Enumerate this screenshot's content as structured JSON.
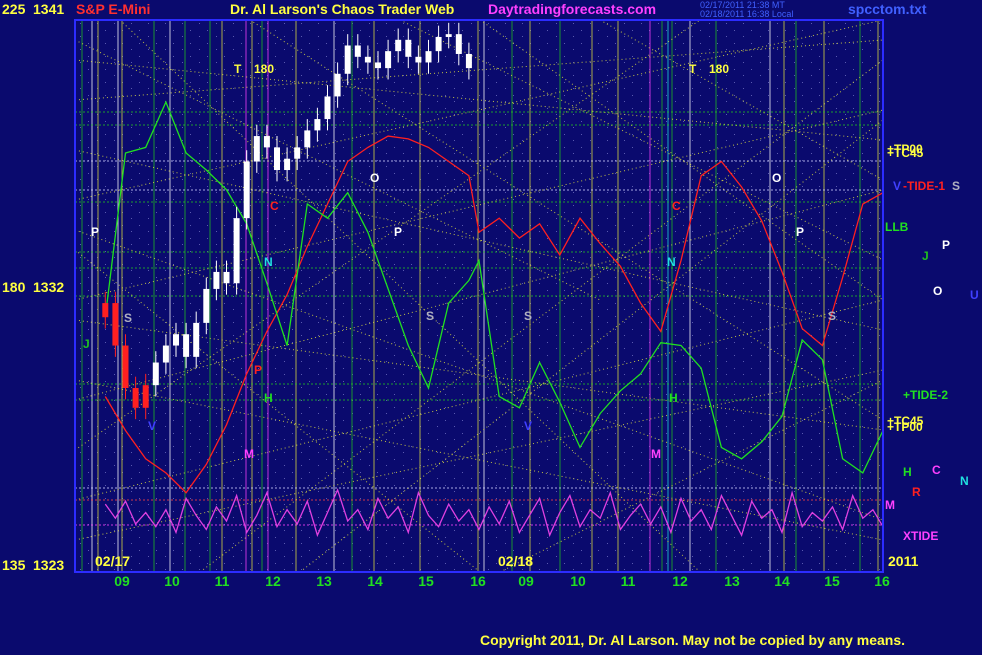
{
  "chart_data": {
    "type": "line",
    "title": "Dr. Al Larson's Chaos Trader Web",
    "site": "Daytradingforecasts.com",
    "instrument": "S&P E-Mini",
    "file": "spcctom.txt",
    "stamp1": "02/17/2011 21:38 MT",
    "stamp2": "02/18/2011 16:38 Local",
    "copyright": "Copyright 2011, Dr. Al Larson. May not be copied by any means.",
    "year": "2011",
    "colors": {
      "background": "#0a0a6e",
      "frame": "#2c2cff",
      "price_candle": "#ffffff",
      "tide1": "#ff2020",
      "tide2": "#20e020",
      "xtide": "#e040e0",
      "dotted_grid": "#e0e040",
      "title_red": "#ff3030",
      "title_yellow": "#ffff40",
      "title_magenta": "#ff40ff"
    },
    "y_left": [
      {
        "label": "225",
        "price": "1341"
      },
      {
        "label": "180",
        "price": "1332"
      },
      {
        "label": "135",
        "price": "1323"
      }
    ],
    "x_ticks": [
      "09",
      "10",
      "11",
      "12",
      "13",
      "14",
      "15",
      "16",
      "09",
      "10",
      "11",
      "12",
      "13",
      "14",
      "15",
      "16"
    ],
    "dates": [
      "02/17",
      "02/18"
    ],
    "t_markers": [
      "T",
      "180",
      "T",
      "180"
    ],
    "planet_markers": [
      "P",
      "S",
      "J",
      "C",
      "N",
      "P",
      "M",
      "H",
      "O",
      "P",
      "S",
      "V",
      "S",
      "N",
      "C",
      "M",
      "H",
      "O",
      "P",
      "S",
      "V"
    ],
    "right_labels": [
      {
        "text": "+TP00",
        "color": "#ffff40"
      },
      {
        "text": "+TC45",
        "color": "#ffff40"
      },
      {
        "text": "V",
        "color": "#4040ff"
      },
      {
        "text": "-TIDE-1",
        "color": "#ff2020"
      },
      {
        "text": "S",
        "color": "#b0b0c0"
      },
      {
        "text": "LLB",
        "color": "#20e020"
      },
      {
        "text": "J",
        "color": "#20c020"
      },
      {
        "text": "P",
        "color": "#ffffff"
      },
      {
        "text": "O",
        "color": "#ffffff"
      },
      {
        "text": "U",
        "color": "#4040ff"
      },
      {
        "text": "+TIDE-2",
        "color": "#20e020"
      },
      {
        "text": "+TC45",
        "color": "#ffff40"
      },
      {
        "text": "+TP00",
        "color": "#ffff40"
      },
      {
        "text": "H",
        "color": "#20e020"
      },
      {
        "text": "C",
        "color": "#ff40ff"
      },
      {
        "text": "N",
        "color": "#20e0e0"
      },
      {
        "text": "R",
        "color": "#ff2020"
      },
      {
        "text": "M",
        "color": "#ff40ff"
      },
      {
        "text": "XTIDE",
        "color": "#ff40ff"
      }
    ],
    "series": [
      {
        "name": "S&P E-Mini",
        "x": [
          8.6,
          8.8,
          9.0,
          9.2,
          9.4,
          9.6,
          9.8,
          10.0,
          10.2,
          10.4,
          10.6,
          10.8,
          11.0,
          11.2,
          11.4,
          11.6,
          11.8,
          12.0,
          12.2,
          12.4,
          12.6,
          12.8,
          13.0,
          13.2,
          13.4,
          13.6,
          13.8,
          14.0,
          14.2,
          14.4,
          14.6,
          14.8,
          15.0,
          15.2,
          15.4,
          15.6,
          15.8
        ],
        "y": [
          1332.5,
          1331.0,
          1329.5,
          1328.8,
          1329.6,
          1330.4,
          1331.0,
          1331.4,
          1330.6,
          1331.8,
          1333.0,
          1333.6,
          1333.2,
          1335.5,
          1337.5,
          1338.4,
          1338.0,
          1337.2,
          1337.6,
          1338.0,
          1338.6,
          1339.0,
          1339.8,
          1340.6,
          1341.6,
          1341.2,
          1341.0,
          1340.8,
          1341.4,
          1341.8,
          1341.2,
          1341.0,
          1341.4,
          1341.9,
          1342.0,
          1341.3,
          1340.8
        ]
      },
      {
        "name": "TIDE-1",
        "x": [
          8.6,
          9.0,
          9.4,
          9.8,
          10.2,
          10.6,
          11.0,
          11.4,
          11.8,
          12.2,
          12.6,
          13.0,
          13.4,
          13.8,
          14.2,
          14.6,
          15.0,
          15.4,
          15.8,
          16.0,
          16.4,
          16.8,
          17.2,
          17.6,
          18.0,
          18.4,
          18.8,
          19.2,
          19.6,
          20.0,
          20.4,
          20.8,
          21.2,
          21.6,
          22.0,
          22.4,
          22.8,
          23.2,
          23.6,
          24.0
        ],
        "y": [
          1329.2,
          1328.0,
          1327.0,
          1326.5,
          1325.8,
          1326.8,
          1328.2,
          1330.0,
          1331.5,
          1332.8,
          1334.5,
          1336.0,
          1337.5,
          1338.0,
          1338.4,
          1338.3,
          1338.0,
          1337.5,
          1337.0,
          1335.0,
          1335.5,
          1334.8,
          1335.3,
          1334.2,
          1335.5,
          1334.6,
          1333.8,
          1332.5,
          1331.5,
          1334.0,
          1337.0,
          1337.5,
          1336.6,
          1335.4,
          1333.6,
          1331.6,
          1331.0,
          1333.4,
          1336.0,
          1336.4
        ]
      },
      {
        "name": "TIDE-2",
        "x": [
          8.6,
          9.0,
          9.4,
          9.8,
          10.2,
          10.6,
          11.0,
          11.4,
          11.8,
          12.2,
          12.6,
          13.0,
          13.4,
          13.8,
          14.2,
          14.6,
          15.0,
          15.4,
          15.8,
          16.0,
          16.4,
          16.8,
          17.2,
          17.6,
          18.0,
          18.4,
          18.8,
          19.2,
          19.6,
          20.0,
          20.4,
          20.8,
          21.2,
          21.6,
          22.0,
          22.4,
          22.8,
          23.2,
          23.6,
          24.0
        ],
        "y": [
          1332.0,
          1337.8,
          1338.0,
          1339.6,
          1337.8,
          1337.2,
          1336.5,
          1335.3,
          1333.2,
          1331.0,
          1336.0,
          1335.5,
          1336.4,
          1335.0,
          1333.0,
          1331.0,
          1329.5,
          1332.5,
          1333.3,
          1334.0,
          1329.2,
          1328.8,
          1330.4,
          1329.0,
          1327.4,
          1328.6,
          1329.4,
          1330.0,
          1331.1,
          1331.0,
          1330.2,
          1327.4,
          1327.0,
          1327.6,
          1328.5,
          1331.2,
          1330.5,
          1327.0,
          1326.5,
          1328.0
        ]
      },
      {
        "name": "XTIDE",
        "x": [
          8.6,
          8.8,
          9.0,
          9.2,
          9.4,
          9.6,
          9.8,
          10.0,
          10.2,
          10.4,
          10.6,
          10.8,
          11.0,
          11.2,
          11.4,
          11.6,
          11.8,
          12.0,
          12.2,
          12.4,
          12.6,
          12.8,
          13.0,
          13.2,
          13.4,
          13.6,
          13.8,
          14.0,
          14.2,
          14.4,
          14.6,
          14.8,
          15.0,
          15.2,
          15.4,
          15.6,
          15.8,
          16.0,
          16.2,
          16.4,
          16.6,
          16.8,
          17.0,
          17.2,
          17.4,
          17.6,
          17.8,
          18.0,
          18.2,
          18.4,
          18.6,
          18.8,
          19.0,
          19.2,
          19.4,
          19.6,
          19.8,
          20.0,
          20.2,
          20.4,
          20.6,
          20.8,
          21.0,
          21.2,
          21.4,
          21.6,
          21.8,
          22.0,
          22.2,
          22.4,
          22.6,
          22.8,
          23.0,
          23.2,
          23.4,
          23.6,
          23.8,
          24.0
        ],
        "y": [
          1325.4,
          1324.9,
          1325.5,
          1324.7,
          1325.1,
          1324.6,
          1325.2,
          1324.4,
          1325.6,
          1325.0,
          1324.5,
          1325.3,
          1324.8,
          1325.7,
          1324.4,
          1325.0,
          1325.8,
          1324.6,
          1325.2,
          1324.7,
          1325.5,
          1324.3,
          1325.1,
          1325.9,
          1324.8,
          1325.2,
          1324.5,
          1325.6,
          1324.9,
          1325.3,
          1324.4,
          1325.8,
          1325.0,
          1324.6,
          1325.4,
          1324.8,
          1325.2,
          1324.5,
          1325.3,
          1324.7,
          1325.5,
          1324.4,
          1325.0,
          1325.6,
          1324.3,
          1325.1,
          1325.7,
          1324.6,
          1325.2,
          1324.9,
          1325.8,
          1324.5,
          1325.0,
          1325.4,
          1324.7,
          1325.3,
          1324.4,
          1325.6,
          1324.8,
          1325.2,
          1324.5,
          1325.7,
          1325.0,
          1324.3,
          1325.5,
          1324.9,
          1325.2,
          1324.4,
          1325.8,
          1324.6,
          1325.1,
          1324.8,
          1325.3,
          1324.5,
          1325.7,
          1324.9,
          1325.2,
          1324.6
        ]
      }
    ],
    "ylim": [
      1323,
      1342.5
    ],
    "xlim": [
      8.0,
      24.0
    ]
  }
}
